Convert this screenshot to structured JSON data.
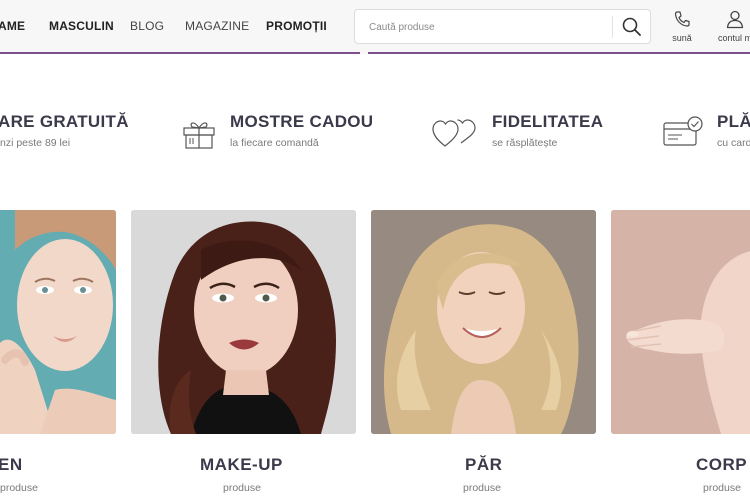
{
  "nav": {
    "items": [
      {
        "label": "AME",
        "bold": true
      },
      {
        "label": "MASCULIN",
        "bold": true
      },
      {
        "label": "BLOG",
        "bold": false
      },
      {
        "label": "MAGAZINE",
        "bold": false
      },
      {
        "label": "PROMOȚII",
        "bold": true
      }
    ]
  },
  "search": {
    "placeholder": "Caută produse"
  },
  "header_links": {
    "call_label": "sună",
    "account_label": "contul m"
  },
  "benefits": [
    {
      "title": "ARE GRATUITĂ",
      "subtitle": "nzi peste 89 lei",
      "icon": "truck-icon"
    },
    {
      "title": "MOSTRE CADOU",
      "subtitle": "la fiecare comandă",
      "icon": "gift-icon"
    },
    {
      "title": "FIDELITATEA",
      "subtitle": "se răsplătește",
      "icon": "hearts-icon"
    },
    {
      "title": "PLĂ",
      "subtitle": "cu card",
      "icon": "card-icon"
    }
  ],
  "categories": [
    {
      "title": "EN",
      "subtitle": "produse"
    },
    {
      "title": "MAKE-UP",
      "subtitle": "produse"
    },
    {
      "title": "PĂR",
      "subtitle": "produse"
    },
    {
      "title": "CORP",
      "subtitle": "produse"
    }
  ],
  "colors": {
    "accent": "#7e4f8e",
    "heading": "#3a3a4a",
    "header_bg": "#f7f7f7"
  }
}
